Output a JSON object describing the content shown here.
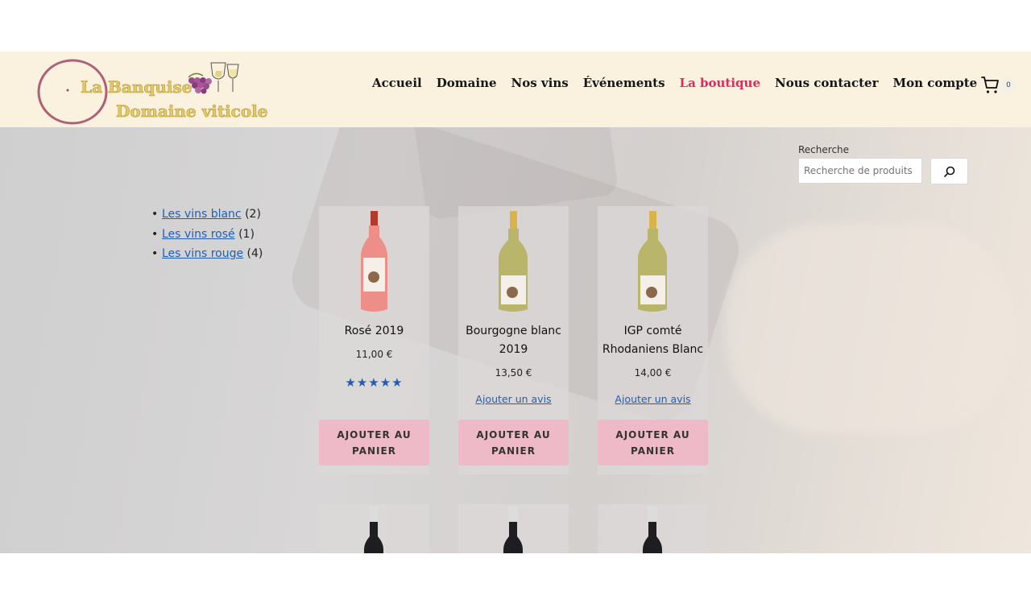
{
  "site": {
    "logo_line1": "La Banquise",
    "logo_line2": "Domaine viticole"
  },
  "nav": {
    "items": [
      {
        "label": "Accueil"
      },
      {
        "label": "Domaine"
      },
      {
        "label": "Nos vins"
      },
      {
        "label": "Événements"
      },
      {
        "label": "La boutique",
        "active": true
      },
      {
        "label": "Nous contacter"
      },
      {
        "label": "Mon compte"
      }
    ],
    "cart_count": "0",
    "cart_icon": "shopping-cart-icon"
  },
  "search": {
    "label": "Recherche",
    "placeholder": "Recherche de produits",
    "button_icon": "search-icon"
  },
  "categories": [
    {
      "label": "Les vins blanc",
      "count": "(2)"
    },
    {
      "label": "Les vins rosé",
      "count": "(1)"
    },
    {
      "label": "Les vins rouge",
      "count": "(4)"
    }
  ],
  "products": [
    {
      "title": "Rosé 2019",
      "price": "11,00 €",
      "rating": 5,
      "review_link": "",
      "button": "AJOUTER AU PANIER",
      "bottle": "rose"
    },
    {
      "title": "Bourgogne blanc 2019",
      "price": "13,50 €",
      "review_link": "Ajouter un avis",
      "button": "AJOUTER AU PANIER",
      "bottle": "white"
    },
    {
      "title": "IGP comté Rhodaniens Blanc",
      "price": "14,00 €",
      "review_link": "Ajouter un avis",
      "button": "AJOUTER AU PANIER",
      "bottle": "white"
    }
  ],
  "colors": {
    "header_bg": "#fbf1df",
    "active_nav": "#dd2c5b",
    "link": "#1f5eb8",
    "button_bg": "#eebac7"
  }
}
